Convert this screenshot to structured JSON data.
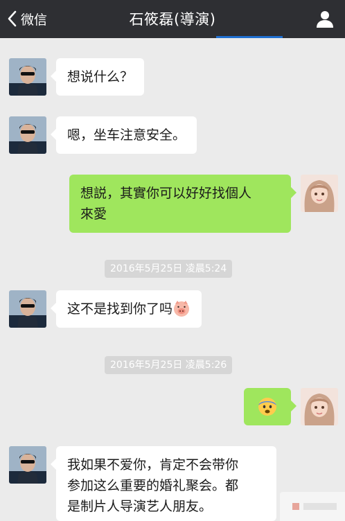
{
  "header": {
    "back_label": "微信",
    "title": "石筱磊(導演)"
  },
  "messages": [
    {
      "side": "left",
      "text": "想说什么？"
    },
    {
      "side": "left",
      "text": "嗯，坐车注意安全。"
    },
    {
      "side": "right",
      "line1": "想説，其實你可以好好找個人",
      "line2": "來愛"
    },
    {
      "side": "left",
      "text": "这不是找到你了吗"
    },
    {
      "side": "right",
      "emoji": "fearful-face"
    },
    {
      "side": "left",
      "line1": "我如果不爱你，肯定不会带你",
      "line2": "参加这么重要的婚礼聚会。都",
      "line3": "是制片人导演艺人朋友。"
    }
  ],
  "timestamps": [
    "2016年5月25日 凌晨5:24",
    "2016年5月25日 凌晨5:26"
  ],
  "icons": {
    "back": "chevron-left-icon",
    "profile": "person-icon",
    "pig": "pig-face-emoji",
    "fearful": "fearful-face-emoji"
  },
  "colors": {
    "header_bg": "#2e2f33",
    "chat_bg": "#ebebeb",
    "bubble_sent": "#9fe65d",
    "bubble_received": "#ffffff",
    "timestamp_bg": "#d6d6d6"
  }
}
